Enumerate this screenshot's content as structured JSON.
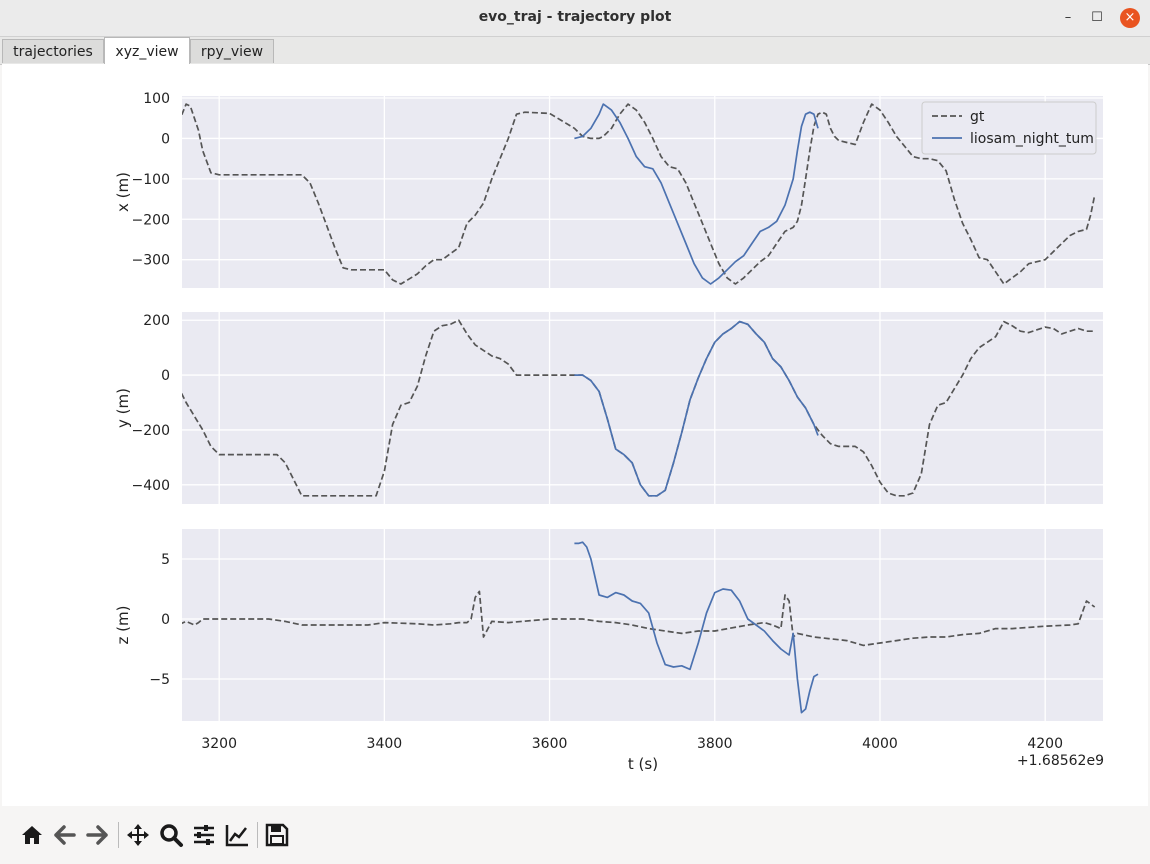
{
  "window": {
    "title": "evo_traj - trajectory plot",
    "minimize": "–",
    "maximize": "☐",
    "close": "×"
  },
  "tabs": [
    {
      "label": "trajectories",
      "active": false
    },
    {
      "label": "xyz_view",
      "active": true
    },
    {
      "label": "rpy_view",
      "active": false
    }
  ],
  "toolbar": {
    "icons": [
      "home-icon",
      "back-icon",
      "forward-icon",
      "pan-icon",
      "zoom-icon",
      "subplots-icon",
      "customize-icon",
      "save-icon"
    ]
  },
  "colors": {
    "gt": "#555555",
    "est": "#4c72b0",
    "axes_bg": "#eaeaf2",
    "grid": "#ffffff"
  },
  "chart_data": {
    "type": "line",
    "xlabel": "t (s)",
    "x_offset_label": "+1.68562e9",
    "xlim": [
      3155,
      4270
    ],
    "xticks": [
      3200,
      3400,
      3600,
      3800,
      4000,
      4200
    ],
    "grid": true,
    "legend": {
      "entries": [
        "gt",
        "liosam_night_tum"
      ],
      "placement": "top-right"
    },
    "subplots": [
      {
        "ylabel": "x (m)",
        "ylim": [
          -370,
          105
        ],
        "yticks": [
          100,
          0,
          -100,
          -200,
          -300
        ],
        "series": [
          {
            "name": "gt",
            "style": "dashed",
            "x": [
              3110,
              3130,
              3135,
              3140,
              3145,
              3150,
              3155,
              3160,
              3165,
              3170,
              3175,
              3180,
              3190,
              3200,
              3250,
              3300,
              3310,
              3320,
              3330,
              3340,
              3350,
              3360,
              3380,
              3390,
              3400,
              3410,
              3420,
              3440,
              3450,
              3460,
              3470,
              3480,
              3490,
              3500,
              3510,
              3520,
              3530,
              3540,
              3550,
              3560,
              3570,
              3600,
              3630,
              3640,
              3650,
              3660,
              3665,
              3675,
              3685,
              3695,
              3705,
              3715,
              3725,
              3735,
              3745,
              3755,
              3765,
              3775,
              3785,
              3795,
              3805,
              3815,
              3825,
              3835,
              3845,
              3855,
              3865,
              3875,
              3885,
              3895,
              3900,
              3905,
              3910,
              3915,
              3920,
              3925,
              3930,
              3935,
              3940,
              3945,
              3950,
              3960,
              3970,
              3980,
              3990,
              4000,
              4010,
              4020,
              4030,
              4040,
              4050,
              4060,
              4070,
              4080,
              4090,
              4100,
              4110,
              4120,
              4130,
              4140,
              4150,
              4160,
              4170,
              4180,
              4190,
              4200,
              4210,
              4220,
              4230,
              4240,
              4250,
              4255,
              4260
            ],
            "y": [
              0,
              0,
              -2,
              -5,
              5,
              35,
              60,
              85,
              80,
              50,
              20,
              -30,
              -85,
              -90,
              -90,
              -90,
              -110,
              -160,
              -215,
              -270,
              -320,
              -325,
              -325,
              -325,
              -325,
              -350,
              -360,
              -335,
              -315,
              -300,
              -300,
              -285,
              -270,
              -210,
              -190,
              -160,
              -100,
              -50,
              0,
              60,
              65,
              62,
              25,
              5,
              0,
              0,
              5,
              25,
              60,
              85,
              70,
              40,
              0,
              -45,
              -70,
              -75,
              -110,
              -160,
              -210,
              -260,
              -310,
              -345,
              -360,
              -345,
              -325,
              -305,
              -290,
              -260,
              -230,
              -220,
              -205,
              -165,
              -100,
              -30,
              30,
              60,
              65,
              60,
              25,
              5,
              -5,
              -10,
              -15,
              40,
              85,
              70,
              40,
              5,
              -20,
              -45,
              -50,
              -50,
              -55,
              -80,
              -150,
              -210,
              -250,
              -295,
              -300,
              -330,
              -360,
              -345,
              -330,
              -310,
              -305,
              -300,
              -280,
              -260,
              -240,
              -230,
              -225,
              -190,
              -140,
              -60,
              -10
            ]
          },
          {
            "name": "liosam_night_tum",
            "style": "solid",
            "x": [
              3630,
              3640,
              3650,
              3660,
              3665,
              3675,
              3685,
              3695,
              3705,
              3715,
              3725,
              3735,
              3745,
              3755,
              3765,
              3775,
              3785,
              3795,
              3805,
              3815,
              3825,
              3835,
              3845,
              3855,
              3865,
              3875,
              3885,
              3895,
              3900,
              3905,
              3910,
              3915,
              3920,
              3925
            ],
            "y": [
              0,
              5,
              25,
              60,
              85,
              70,
              40,
              0,
              -45,
              -70,
              -75,
              -110,
              -160,
              -210,
              -260,
              -310,
              -345,
              -360,
              -345,
              -325,
              -305,
              -290,
              -260,
              -230,
              -220,
              -205,
              -165,
              -100,
              -30,
              30,
              60,
              65,
              60,
              25
            ]
          }
        ]
      },
      {
        "ylabel": "y (m)",
        "ylim": [
          -470,
          230
        ],
        "yticks": [
          200,
          0,
          -200,
          -400
        ],
        "series": [
          {
            "name": "gt",
            "style": "dashed",
            "x": [
              3110,
              3125,
              3140,
              3150,
              3160,
              3170,
              3180,
              3190,
              3200,
              3250,
              3270,
              3280,
              3290,
              3300,
              3380,
              3390,
              3400,
              3410,
              3420,
              3430,
              3440,
              3450,
              3460,
              3470,
              3480,
              3490,
              3500,
              3510,
              3520,
              3530,
              3540,
              3550,
              3560,
              3600,
              3630,
              3640,
              3650,
              3660,
              3670,
              3680,
              3690,
              3700,
              3710,
              3720,
              3730,
              3740,
              3750,
              3760,
              3770,
              3780,
              3790,
              3800,
              3810,
              3820,
              3830,
              3840,
              3850,
              3860,
              3870,
              3880,
              3890,
              3900,
              3910,
              3920,
              3930,
              3940,
              3950,
              3960,
              3970,
              3980,
              3990,
              4000,
              4010,
              4020,
              4030,
              4040,
              4050,
              4060,
              4070,
              4080,
              4090,
              4100,
              4110,
              4120,
              4130,
              4140,
              4150,
              4160,
              4170,
              4180,
              4190,
              4200,
              4210,
              4220,
              4230,
              4240,
              4250,
              4260
            ],
            "y": [
              0,
              0,
              -10,
              -40,
              -100,
              -150,
              -200,
              -260,
              -290,
              -290,
              -290,
              -320,
              -380,
              -440,
              -440,
              -440,
              -350,
              -180,
              -110,
              -100,
              -40,
              70,
              160,
              180,
              185,
              200,
              150,
              110,
              90,
              70,
              60,
              40,
              0,
              0,
              0,
              0,
              -20,
              -60,
              -160,
              -270,
              -290,
              -320,
              -400,
              -440,
              -440,
              -420,
              -320,
              -210,
              -90,
              -10,
              60,
              120,
              150,
              170,
              195,
              185,
              150,
              120,
              60,
              30,
              -20,
              -80,
              -120,
              -180,
              -220,
              -250,
              -260,
              -260,
              -260,
              -280,
              -330,
              -390,
              -430,
              -440,
              -440,
              -430,
              -360,
              -180,
              -110,
              -100,
              -50,
              0,
              60,
              100,
              120,
              140,
              195,
              180,
              160,
              155,
              165,
              175,
              170,
              150,
              160,
              170,
              160,
              160
            ]
          },
          {
            "name": "liosam_night_tum",
            "style": "solid",
            "x": [
              3630,
              3640,
              3650,
              3660,
              3670,
              3680,
              3690,
              3700,
              3710,
              3720,
              3730,
              3740,
              3750,
              3760,
              3770,
              3780,
              3790,
              3800,
              3810,
              3820,
              3830,
              3840,
              3850,
              3860,
              3870,
              3880,
              3890,
              3900,
              3910,
              3920,
              3925
            ],
            "y": [
              0,
              0,
              -20,
              -60,
              -160,
              -270,
              -290,
              -320,
              -400,
              -440,
              -440,
              -420,
              -320,
              -210,
              -90,
              -10,
              60,
              120,
              150,
              170,
              195,
              185,
              150,
              120,
              60,
              30,
              -20,
              -80,
              -120,
              -180,
              -220
            ]
          }
        ]
      },
      {
        "ylabel": "z (m)",
        "ylim": [
          -8.5,
          7.5
        ],
        "yticks": [
          5,
          0,
          -5
        ],
        "series": [
          {
            "name": "gt",
            "style": "dashed",
            "x": [
              3110,
              3130,
              3140,
              3150,
              3160,
              3170,
              3175,
              3180,
              3200,
              3260,
              3280,
              3300,
              3380,
              3400,
              3440,
              3460,
              3480,
              3490,
              3500,
              3505,
              3510,
              3515,
              3520,
              3530,
              3550,
              3600,
              3640,
              3660,
              3680,
              3700,
              3720,
              3740,
              3760,
              3780,
              3800,
              3840,
              3860,
              3870,
              3880,
              3885,
              3890,
              3895,
              3900,
              3920,
              3960,
              3980,
              4000,
              4020,
              4040,
              4060,
              4080,
              4100,
              4120,
              4140,
              4160,
              4200,
              4230,
              4240,
              4250,
              4260
            ],
            "y": [
              0,
              0,
              -0.2,
              -0.5,
              -0.2,
              -0.5,
              -0.3,
              0,
              0,
              0,
              -0.2,
              -0.5,
              -0.5,
              -0.3,
              -0.4,
              -0.5,
              -0.4,
              -0.3,
              -0.3,
              0,
              1.8,
              2.3,
              -1.5,
              -0.2,
              -0.3,
              0,
              0,
              -0.2,
              -0.3,
              -0.5,
              -0.8,
              -1.0,
              -1.2,
              -1.0,
              -1.0,
              -0.5,
              -0.3,
              -0.5,
              -0.8,
              2.0,
              1.5,
              -1.5,
              -1.2,
              -1.5,
              -1.8,
              -2.2,
              -2.0,
              -1.8,
              -1.6,
              -1.5,
              -1.5,
              -1.3,
              -1.2,
              -0.8,
              -0.8,
              -0.6,
              -0.5,
              -0.4,
              1.5,
              1.0
            ]
          },
          {
            "name": "liosam_night_tum",
            "style": "solid",
            "x": [
              3630,
              3635,
              3640,
              3645,
              3650,
              3660,
              3670,
              3680,
              3690,
              3700,
              3710,
              3720,
              3730,
              3740,
              3750,
              3760,
              3770,
              3780,
              3790,
              3800,
              3810,
              3820,
              3830,
              3840,
              3850,
              3860,
              3870,
              3880,
              3890,
              3895,
              3900,
              3905,
              3910,
              3915,
              3920,
              3925
            ],
            "y": [
              6.3,
              6.3,
              6.4,
              6.0,
              5.0,
              2.0,
              1.8,
              2.2,
              2.0,
              1.5,
              1.3,
              0.5,
              -2.0,
              -3.8,
              -4.0,
              -3.9,
              -4.2,
              -2.0,
              0.5,
              2.2,
              2.5,
              2.4,
              1.5,
              0,
              -0.5,
              -1.0,
              -1.8,
              -2.5,
              -3.0,
              -1.2,
              -5.0,
              -7.8,
              -7.5,
              -6.0,
              -4.8,
              -4.6
            ]
          }
        ]
      }
    ]
  }
}
